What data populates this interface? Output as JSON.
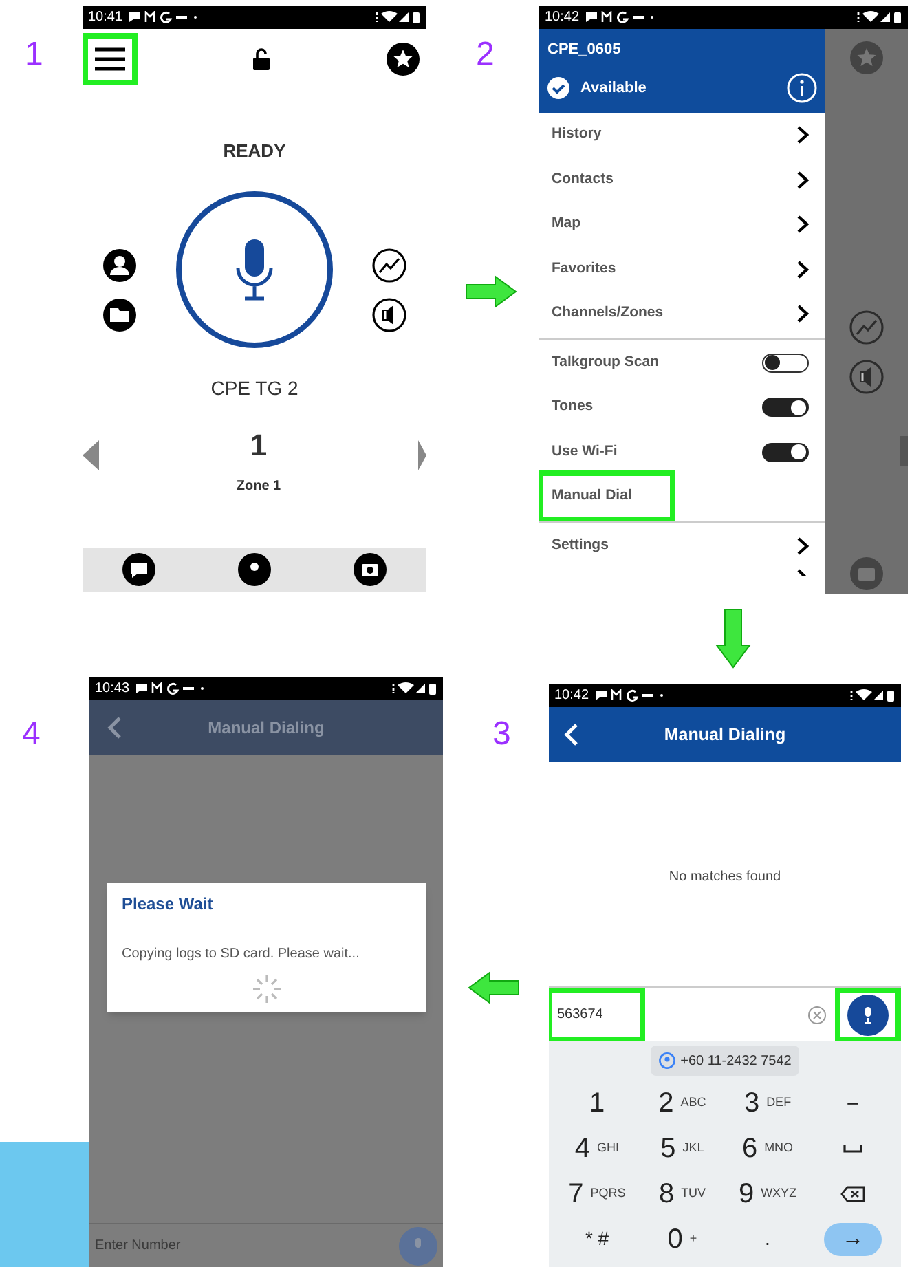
{
  "step_labels": [
    "1",
    "2",
    "4",
    "3"
  ],
  "home_screen": {
    "status_time": "10:41",
    "menu_highlighted": true,
    "state": "READY",
    "talkgroup": "CPE TG 2",
    "channel": "1",
    "zone": "Zone 1"
  },
  "menu_screen": {
    "status_time": "10:42",
    "user": "CPE_0605",
    "presence": "Available",
    "sections": [
      [
        {
          "kind": "link",
          "label": "History",
          "highlighted": false
        },
        {
          "kind": "link",
          "label": "Contacts",
          "highlighted": false
        },
        {
          "kind": "link",
          "label": "Map",
          "highlighted": false
        },
        {
          "kind": "link",
          "label": "Favorites",
          "highlighted": false
        },
        {
          "kind": "link",
          "label": "Channels/Zones",
          "highlighted": false
        }
      ],
      [
        {
          "kind": "toggle",
          "label": "Talkgroup Scan",
          "on": false,
          "highlighted": false
        },
        {
          "kind": "toggle",
          "label": "Tones",
          "on": true,
          "highlighted": false
        },
        {
          "kind": "toggle",
          "label": "Use Wi-Fi",
          "on": true,
          "highlighted": false
        },
        {
          "kind": "plain",
          "label": "Manual Dial",
          "highlighted": true
        }
      ],
      [
        {
          "kind": "link",
          "label": "Settings",
          "highlighted": false
        }
      ]
    ]
  },
  "dialing_screen": {
    "status_time": "10:42",
    "title": "Manual Dialing",
    "message": "No matches found",
    "number_field": {
      "value": "563674",
      "highlighted": true
    },
    "call_button": {
      "highlighted": true
    },
    "suggestion": "+60 11-2432 7542",
    "keys": [
      {
        "kind": "digit",
        "label": "1"
      },
      {
        "kind": "digit",
        "label": "2",
        "letters": "ABC"
      },
      {
        "kind": "digit",
        "label": "3",
        "letters": "DEF"
      },
      {
        "kind": "symbol",
        "label": "–"
      },
      {
        "kind": "digit",
        "label": "4",
        "letters": "GHI"
      },
      {
        "kind": "digit",
        "label": "5",
        "letters": "JKL"
      },
      {
        "kind": "digit",
        "label": "6",
        "letters": "MNO"
      },
      {
        "kind": "space"
      },
      {
        "kind": "digit",
        "label": "7",
        "letters": "PQRS"
      },
      {
        "kind": "digit",
        "label": "8",
        "letters": "TUV"
      },
      {
        "kind": "digit",
        "label": "9",
        "letters": "WXYZ"
      },
      {
        "kind": "backspace"
      },
      {
        "kind": "symbol",
        "label": "* #"
      },
      {
        "kind": "digit",
        "label": "0",
        "letters": "+"
      },
      {
        "kind": "symbol",
        "label": "."
      },
      {
        "kind": "enter",
        "label": "→"
      }
    ]
  },
  "wait_screen": {
    "status_time": "10:43",
    "title": "Manual Dialing",
    "dialog_title": "Please Wait",
    "dialog_message": "Copying logs to SD card. Please wait...",
    "field_placeholder": "Enter Number"
  }
}
